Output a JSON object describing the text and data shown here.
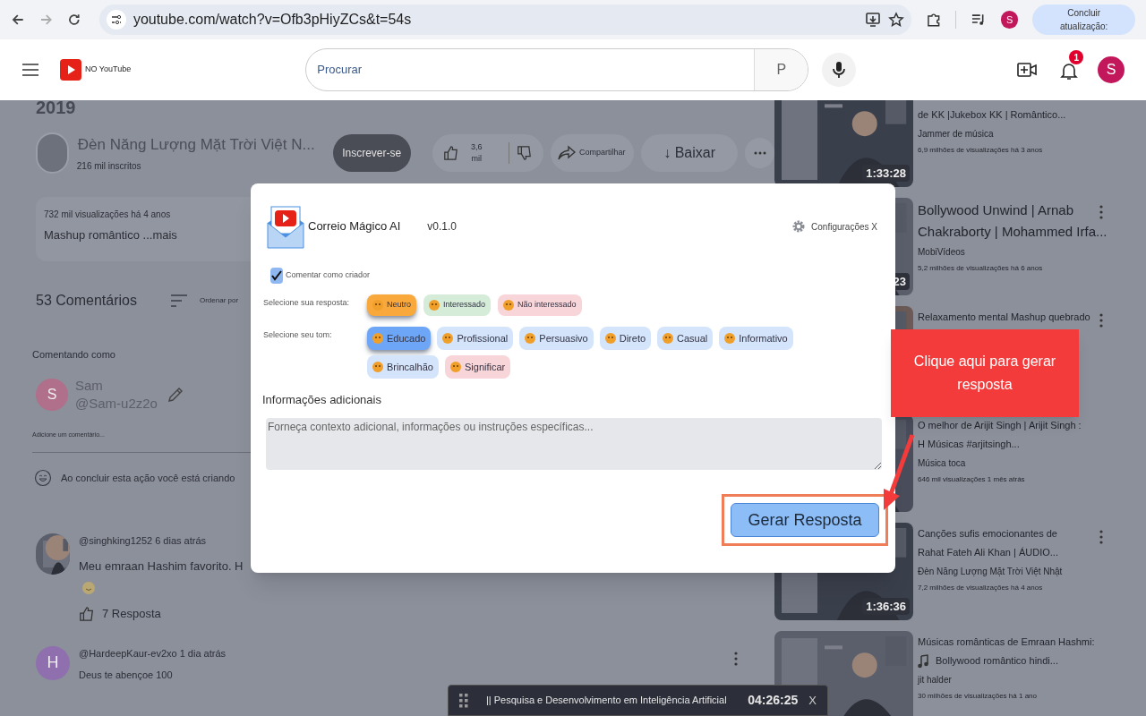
{
  "browser": {
    "url": "youtube.com/watch?v=Ofb3pHiyZCs&t=54s",
    "profile_letter": "S",
    "update_button": "Concluir atualização:"
  },
  "header": {
    "logo_text": "NO YouTube",
    "search_placeholder": "Procurar",
    "search_button": "P",
    "notification_count": "1",
    "avatar_letter": "S"
  },
  "video": {
    "year": "2019",
    "channel_name": "Đèn Năng Lượng Mặt Trời Việt N...",
    "subscribers": "216 mil inscritos",
    "subscribe": "Inscrever-se",
    "likes": "3,6 mil",
    "share": "Compartilhar",
    "download": "↓ Baixar",
    "description_meta": "732 mil visualizações há 4 anos",
    "description_text": "Mashup romântico ...mais"
  },
  "comments": {
    "title": "53 Comentários",
    "sort": "Ordenar por",
    "commenting_as": "Comentando como",
    "user": {
      "letter": "S",
      "name": "Sam",
      "handle": "@Sam-u2z2o"
    },
    "add_placeholder": "Adicione um comentário...",
    "notice": "Ao concluir esta ação você está criando",
    "items": [
      {
        "author": "@singhking1252 6 dias atrás",
        "text": "Meu emraan Hashim favorito. H",
        "emoji": true,
        "replies": "7 Resposta",
        "menu": false
      },
      {
        "avatar": {
          "kind": "letter",
          "letter": "H"
        },
        "author": "@HardeepKaur-ev2xo 1 dia atrás",
        "text": "Deus te abençoe 100",
        "emoji": false,
        "menu": true
      }
    ]
  },
  "sidebar": [
    {
      "lines": [
        "de KK |Jukebox KK | Romântico..."
      ],
      "channel": "Jammer de música",
      "meta": "6,9 milhões de visualizações há 3 anos",
      "duration": "1:33:28",
      "menu": false
    },
    {
      "lines": [
        "Bollywood Unwind | Arnab Chakraborty | Mohammed Irfa..."
      ],
      "channel": "MobiVídeos",
      "meta": "5,2 milhões de visualizações há 6 anos",
      "duration": "23",
      "menu": true
    },
    {
      "lines": [
        "Relaxamento mental Mashup quebrado"
      ],
      "menu": true
    },
    {
      "lines": [
        "O melhor de Arijit Singh | Arijit Singh :",
        "H Músicas #arjitsingh..."
      ],
      "channel": "Música toca",
      "meta": "646 mil visualizações 1 mês atrás",
      "menu": false
    },
    {
      "lines": [
        "Canções sufis emocionantes de",
        "Rahat Fateh Ali Khan | ÁUDIO..."
      ],
      "channel": "Đèn Năng Lượng Mặt Trời Việt Nhật",
      "meta": "7,2 milhões de visualizações há 4 anos",
      "duration": "1:36:36",
      "menu": true
    },
    {
      "lines": [
        "Músicas românticas de Emraan Hashmi:",
        {
          "text": "Bollywood romântico hindi...",
          "kind": "music"
        }
      ],
      "channel": "jit halder",
      "meta": "30 milhões de visualizações há 1 ano",
      "menu": false
    }
  ],
  "modal": {
    "title": "Correio Mágico AI",
    "version": "v0.1.0",
    "settings": "Configurações X",
    "creator_checkbox": {
      "label": "Comentar como criador",
      "checked": true
    },
    "response_label": "Selecione sua resposta:",
    "responses": [
      {
        "label": "Neutro",
        "color": "#f9a93b",
        "selected": true
      },
      {
        "label": "Interessado",
        "color": "#d5ecd9",
        "selected": false
      },
      {
        "label": "Não interessado",
        "color": "#f8d5d8",
        "selected": false
      }
    ],
    "tone_label": "Selecione seu tom:",
    "tones": [
      {
        "label": "Educado",
        "color": "#6ea6f7",
        "selected": true
      },
      {
        "label": "Profissional",
        "color": "#d3e4fb",
        "selected": false
      },
      {
        "label": "Persuasivo",
        "color": "#d3e4fb",
        "selected": false
      },
      {
        "label": "Direto",
        "color": "#d3e4fb",
        "selected": false
      },
      {
        "label": "Casual",
        "color": "#d3e4fb",
        "selected": false
      },
      {
        "label": "Informativo",
        "color": "#d3e4fb",
        "selected": false
      },
      {
        "label": "Brincalhão",
        "color": "#d3e4fb",
        "selected": false
      },
      {
        "label": "Significar",
        "color": "#f8d5d8",
        "selected": false
      }
    ],
    "info_title": "Informações adicionais",
    "info_placeholder": "Forneça contexto adicional, informações ou instruções específicas...",
    "generate_button": "Gerar Resposta"
  },
  "callout": {
    "text": "Clique aqui para gerar resposta"
  },
  "bottom_bar": {
    "text": "|| Pesquisa e Desenvolvimento em Inteligência Artificial",
    "time": "04:26:25",
    "close": "X"
  }
}
